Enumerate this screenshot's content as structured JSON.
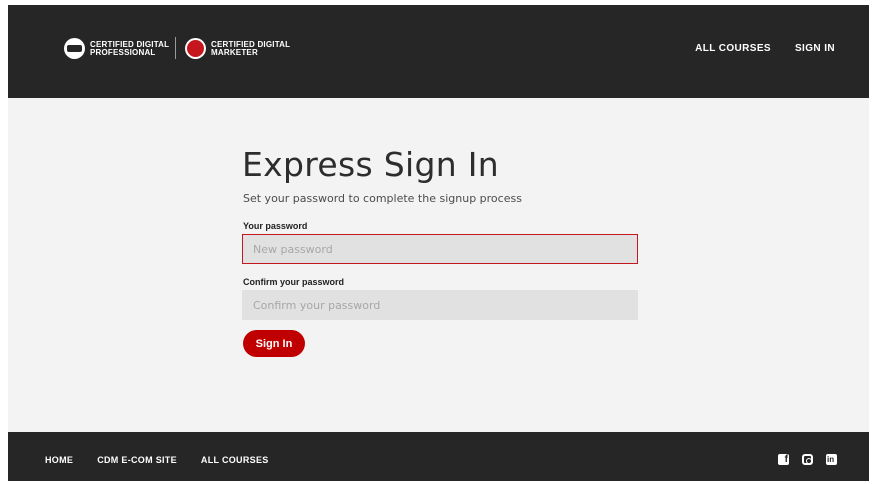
{
  "header": {
    "logo1": {
      "line1": "CERTIFIED DIGITAL",
      "line2": "PROFESSIONAL",
      "badge": "CDP"
    },
    "logo2": {
      "line1": "CERTIFIED DIGITAL",
      "line2": "MARKETER",
      "badge": "CDM"
    },
    "nav": {
      "all_courses": "ALL COURSES",
      "sign_in": "SIGN IN"
    }
  },
  "main": {
    "title": "Express Sign In",
    "subtitle": "Set your password to complete the signup process",
    "password": {
      "label": "Your password",
      "placeholder": "New password",
      "value": ""
    },
    "confirm": {
      "label": "Confirm your password",
      "placeholder": "Confirm your password",
      "value": ""
    },
    "submit_label": "Sign In"
  },
  "footer": {
    "links": {
      "home": "HOME",
      "ecom": "CDM E-COM SITE",
      "courses": "ALL COURSES"
    },
    "social": [
      "facebook-icon",
      "instagram-icon",
      "linkedin-icon"
    ]
  },
  "colors": {
    "brand_red": "#c00000",
    "dark_bg": "#262626",
    "page_bg": "#f3f3f3",
    "input_bg": "#e1e1e1"
  }
}
